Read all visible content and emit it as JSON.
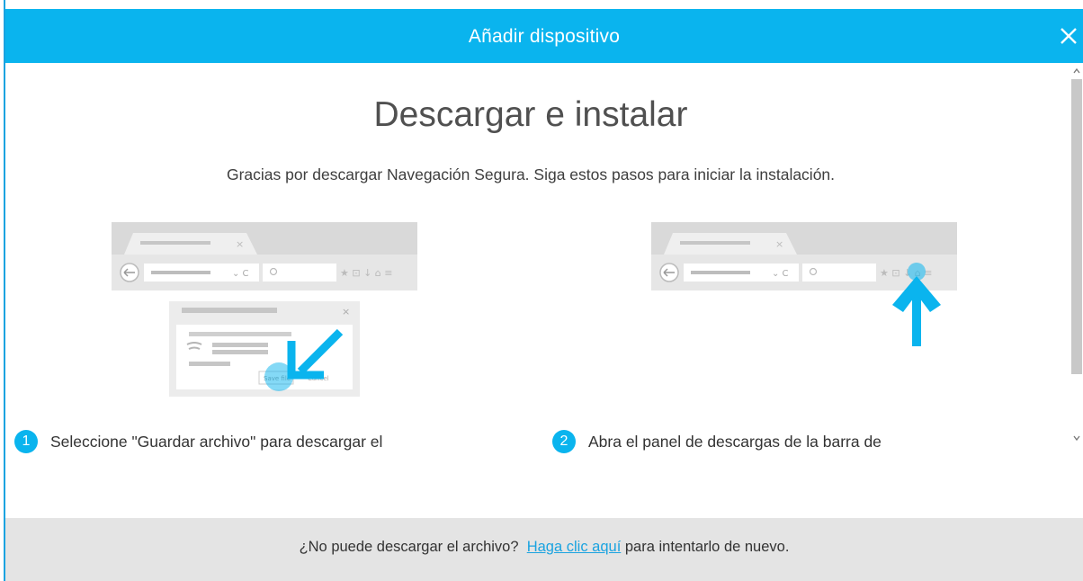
{
  "dialog": {
    "title": "Añadir dispositivo",
    "close_label": "×"
  },
  "main": {
    "heading": "Descargar e instalar",
    "subtitle": "Gracias por descargar Navegación Segura. Siga estos pasos para iniciar la instalación."
  },
  "steps": [
    {
      "number": "1",
      "text": "Seleccione \"Guardar archivo\" para descargar el"
    },
    {
      "number": "2",
      "text": "Abra el panel de descargas de la barra de"
    }
  ],
  "illustration": {
    "save_button": "Save file",
    "cancel_button": "Cancel"
  },
  "footer": {
    "prefix": "¿No puede descargar el archivo?",
    "link": "Haga clic aquí",
    "suffix": "para intentarlo de nuevo."
  },
  "colors": {
    "accent": "#0ab4ee",
    "link": "#1aa3e0",
    "footer_bg": "#e4e4e4"
  }
}
